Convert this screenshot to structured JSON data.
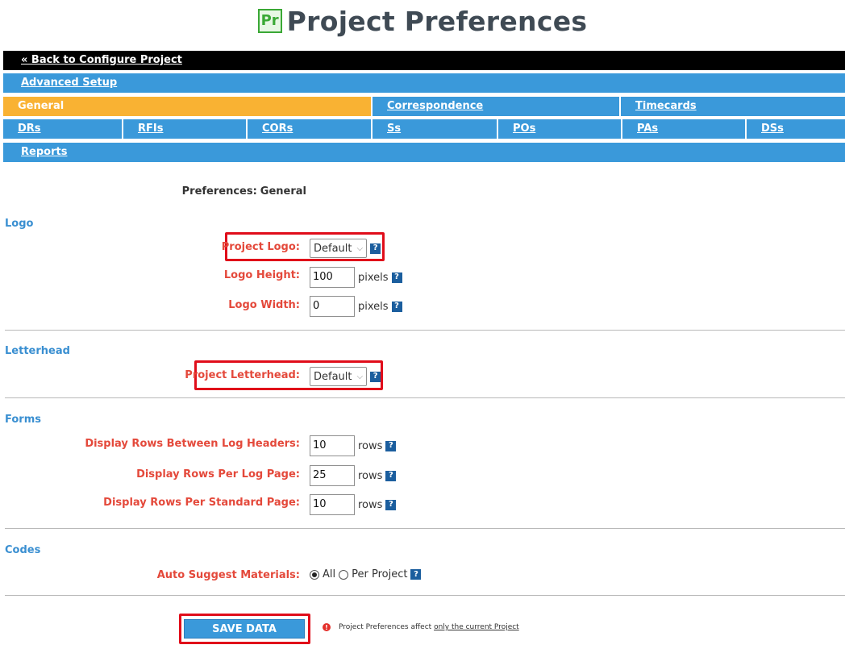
{
  "header": {
    "logo_text": "Pr",
    "title": "Project Preferences"
  },
  "nav": {
    "back": "« Back to Configure Project",
    "advanced": "Advanced Setup",
    "row3": [
      "General",
      "Correspondence",
      "Timecards"
    ],
    "row4": [
      "DRs",
      "RFIs",
      "CORs",
      "Ss",
      "POs",
      "PAs",
      "DSs"
    ],
    "reports": "Reports",
    "active_tab": "General"
  },
  "preferences": {
    "label": "Preferences:",
    "value": "General"
  },
  "sections": {
    "logo": "Logo",
    "letterhead": "Letterhead",
    "forms": "Forms",
    "codes": "Codes"
  },
  "fields": {
    "project_logo": {
      "label": "Project Logo:",
      "value": "Default"
    },
    "logo_height": {
      "label": "Logo Height:",
      "value": "100",
      "unit": "pixels"
    },
    "logo_width": {
      "label": "Logo Width:",
      "value": "0",
      "unit": "pixels"
    },
    "project_letterhead": {
      "label": "Project Letterhead:",
      "value": "Default"
    },
    "rows_between_headers": {
      "label": "Display Rows Between Log Headers:",
      "value": "10",
      "unit": "rows"
    },
    "rows_per_log_page": {
      "label": "Display Rows Per Log Page:",
      "value": "25",
      "unit": "rows"
    },
    "rows_per_standard_page": {
      "label": "Display Rows Per Standard Page:",
      "value": "10",
      "unit": "rows"
    },
    "auto_suggest": {
      "label": "Auto Suggest Materials:",
      "option_all": "All",
      "option_per_project": "Per Project",
      "selected": "All"
    }
  },
  "help_glyph": "?",
  "save": {
    "label": "SAVE DATA",
    "notice_prefix": "Project Preferences affect",
    "notice_link": "only the current Project",
    "warn_glyph": "!"
  },
  "colors": {
    "nav_blue": "#3a99da",
    "active_orange": "#f9b233",
    "label_red": "#e4493b",
    "section_blue": "#3a8fd1",
    "highlight_red": "#e00d1a"
  }
}
